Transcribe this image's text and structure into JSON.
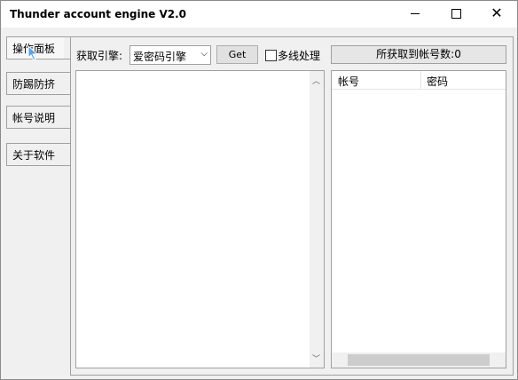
{
  "window": {
    "title": "Thunder account engine  V2.0"
  },
  "sidebar": {
    "tabs": [
      {
        "label": "操作面板"
      },
      {
        "label": "防踢防挤"
      },
      {
        "label": "帐号说明"
      },
      {
        "label": "关于软件"
      }
    ]
  },
  "toolbar": {
    "engine_label": "获取引擎:",
    "engine_value": "爱密码引擎",
    "get_label": "Get",
    "multithread_label": "多线处理",
    "count_status": "所获取到帐号数:0"
  },
  "results": {
    "columns": [
      "帐号",
      "密码"
    ]
  },
  "icons": {
    "minimize": "minimize-icon",
    "maximize": "maximize-icon",
    "close": "close-icon",
    "cursor": "cursor-icon",
    "scroll_up": "scroll-up-icon",
    "scroll_down": "scroll-down-icon",
    "dropdown": "chevron-down-icon"
  }
}
